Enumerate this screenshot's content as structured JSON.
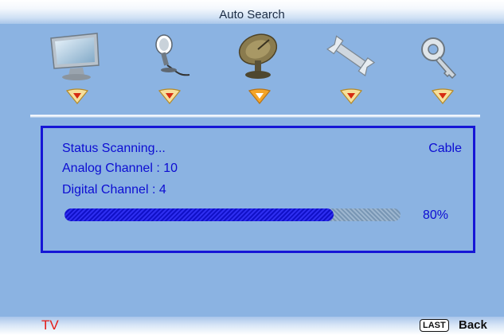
{
  "header": {
    "title": "Auto Search"
  },
  "menu": {
    "icons": [
      "monitor-icon",
      "microphone-icon",
      "satellite-dish-icon",
      "wrench-icon",
      "key-icon"
    ],
    "active_index": 2
  },
  "status_panel": {
    "status_text": "Status Scanning...",
    "mode": "Cable",
    "analog_channel": "Analog Channel : 10",
    "digital_channel": "Digital Channel : 4",
    "progress_value": 0.8,
    "progress_text": "80%"
  },
  "footer": {
    "source": "TV",
    "last_key": "LAST",
    "back_label": "Back"
  },
  "colors": {
    "background": "#8bb3e2",
    "text_blue": "#0d0dd2",
    "panel_border": "#1616d6",
    "progress_fill": "#1a1ad8",
    "source_red": "#e41b17",
    "selector_active": "#f4a428",
    "selector_inactive": "#f6df9a",
    "selector_arrow": "#d62a12"
  }
}
